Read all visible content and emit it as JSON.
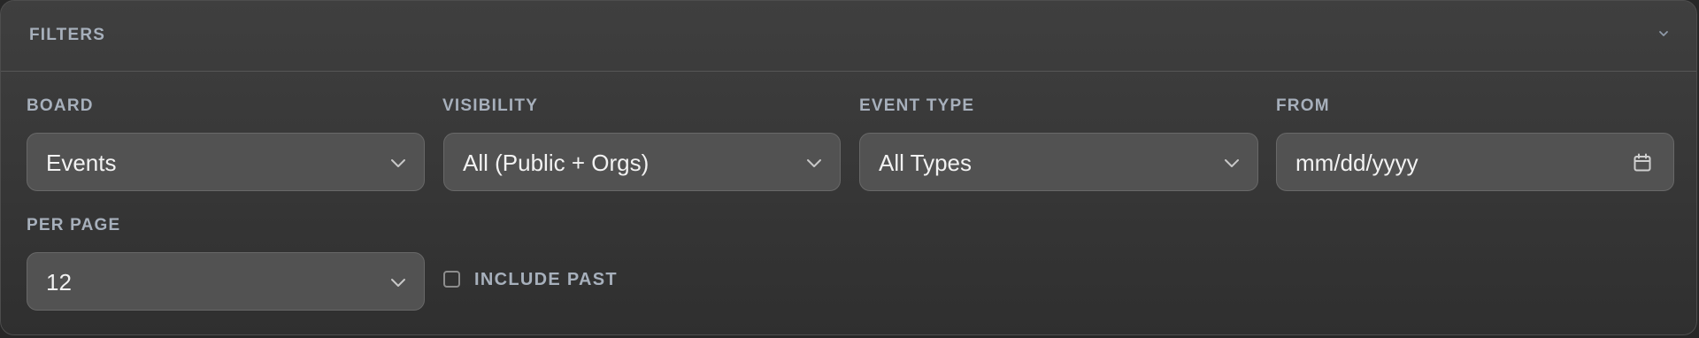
{
  "filters": {
    "title": "FILTERS",
    "collapse_icon": "chevron-down-icon",
    "board": {
      "label": "BOARD",
      "value": "Events",
      "icon": "chevron-down-icon"
    },
    "visibility": {
      "label": "VISIBILITY",
      "value": "All (Public + Orgs)",
      "icon": "chevron-down-icon"
    },
    "event_type": {
      "label": "EVENT TYPE",
      "value": "All Types",
      "icon": "chevron-down-icon"
    },
    "from": {
      "label": "FROM",
      "placeholder": "mm/dd/yyyy",
      "icon": "calendar-icon"
    },
    "per_page": {
      "label": "PER PAGE",
      "value": "12",
      "icon": "chevron-down-icon"
    },
    "include_past": {
      "label": "INCLUDE PAST",
      "checked": false
    }
  },
  "colors": {
    "panel_background": "#3b3b3b",
    "control_background": "#525252",
    "label_text": "#a7b0bc",
    "value_text": "#f2f2f2",
    "border": "#686868"
  }
}
